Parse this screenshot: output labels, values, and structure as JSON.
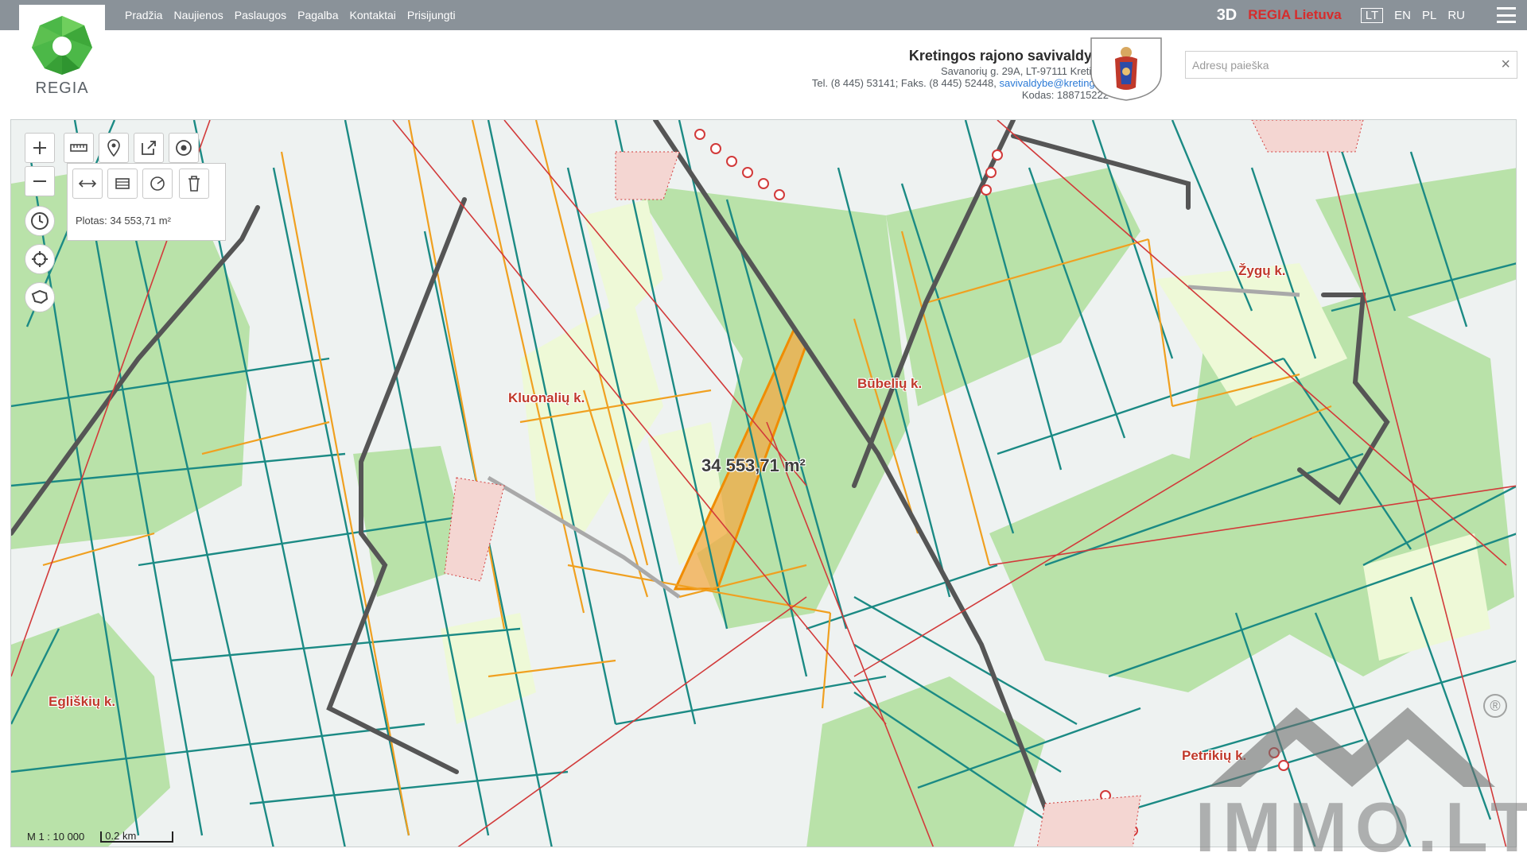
{
  "topnav": {
    "items": [
      "Pradžia",
      "Naujienos",
      "Paslaugos",
      "Pagalba",
      "Kontaktai",
      "Prisijungti"
    ],
    "btn_3d": "3D",
    "regia_lietuva": "REGIA Lietuva",
    "languages": [
      "LT",
      "EN",
      "PL",
      "RU"
    ],
    "active_language": "LT"
  },
  "logo": {
    "text": "REGIA"
  },
  "municipality": {
    "name": "Kretingos rajono savivaldybė",
    "address": "Savanorių g. 29A, LT-97111 Kretinga",
    "phone": "Tel. (8 445) 53141; Faks. (8 445) 52448,",
    "email": "savivaldybe@kretinga.lt",
    "code": "Kodas: 188715222"
  },
  "search": {
    "placeholder": "Adresų paieška",
    "clear_icon": "×"
  },
  "map": {
    "measure": {
      "area_text": "Plotas: 34 553,71 m²"
    },
    "area_label": "34 553,71 m²",
    "places": [
      "Kluonalių k.",
      "Būbelių k.",
      "Žygų k.",
      "Egliškių k.",
      "Petrikių k."
    ],
    "scale_ratio": "M 1 : 10 000",
    "scale_bar": "0.2 km",
    "watermark": "IMMO.LT",
    "watermark_mark": "®"
  },
  "colors": {
    "topbar": "#8a9299",
    "parcel_teal": "#1b8a84",
    "parcel_orange": "#f0a020",
    "forest": "#b9e2a9",
    "field": "#eef9d7",
    "road": "#555555",
    "selected": "#f3a945",
    "label_red": "#c0392b"
  }
}
